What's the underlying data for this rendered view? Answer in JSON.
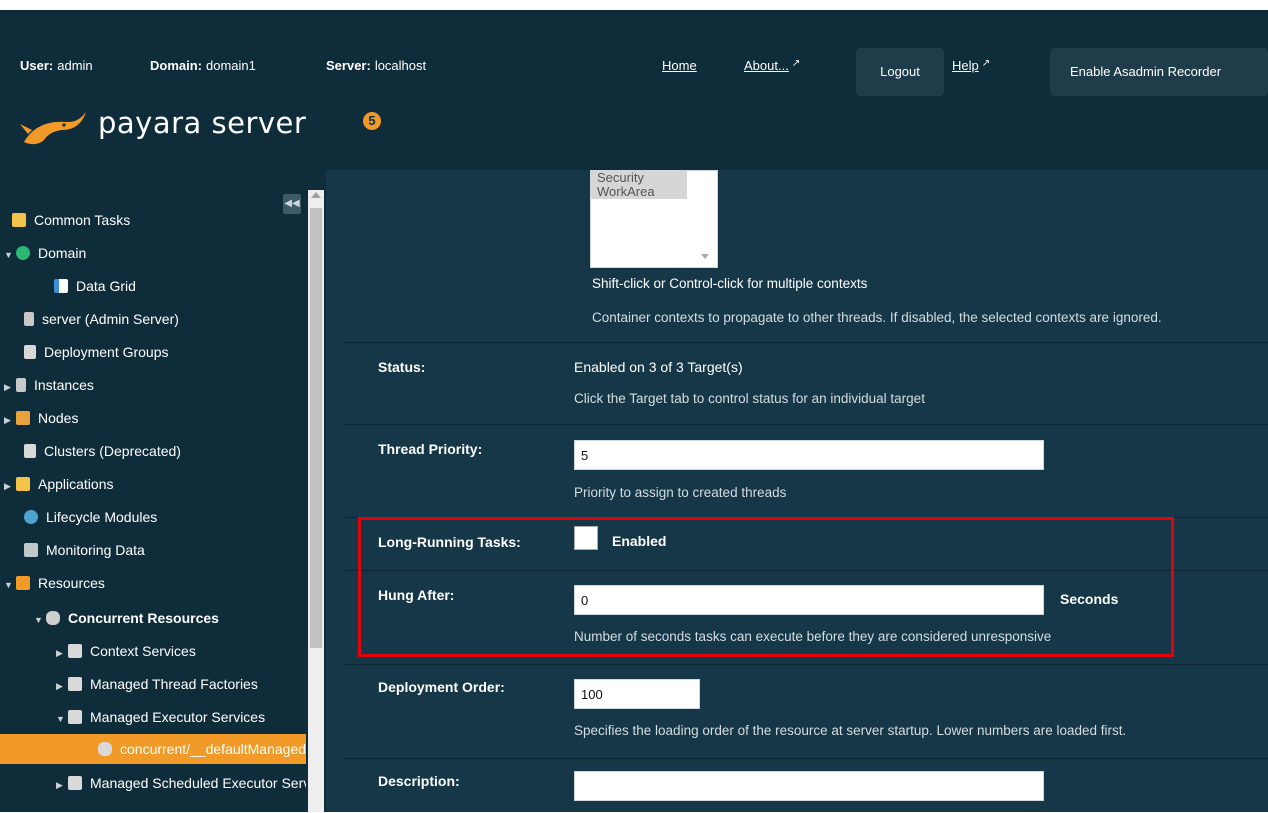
{
  "header": {
    "user_label": "User:",
    "user_value": "admin",
    "domain_label": "Domain:",
    "domain_value": "domain1",
    "server_label": "Server:",
    "server_value": "localhost",
    "home_link": "Home",
    "about_link": "About...",
    "logout_button": "Logout",
    "help_link": "Help",
    "recorder_button": "Enable Asadmin Recorder",
    "logo_text": "payara server",
    "logo_badge": "5"
  },
  "sidebar": {
    "items": [
      {
        "label": "Common Tasks",
        "icon": "tasks-icon"
      },
      {
        "label": "Domain",
        "icon": "globe-icon"
      },
      {
        "label": "Data Grid",
        "icon": "datagrid-icon"
      },
      {
        "label": "server (Admin Server)",
        "icon": "server-icon"
      },
      {
        "label": "Deployment Groups",
        "icon": "hierarchy-icon"
      },
      {
        "label": "Instances",
        "icon": "server-icon"
      },
      {
        "label": "Nodes",
        "icon": "monitor-icon"
      },
      {
        "label": "Clusters (Deprecated)",
        "icon": "hierarchy-icon"
      },
      {
        "label": "Applications",
        "icon": "applications-icon"
      },
      {
        "label": "Lifecycle Modules",
        "icon": "gear-icon"
      },
      {
        "label": "Monitoring Data",
        "icon": "monitor-icon"
      },
      {
        "label": "Resources",
        "icon": "resources-icon"
      },
      {
        "label": "Concurrent Resources",
        "icon": "database-icon"
      },
      {
        "label": "Context Services",
        "icon": "folder-icon"
      },
      {
        "label": "Managed Thread Factories",
        "icon": "folder-icon"
      },
      {
        "label": "Managed Executor Services",
        "icon": "folder-icon"
      },
      {
        "label": "concurrent/__defaultManagedExecutorService",
        "icon": "database-icon"
      },
      {
        "label": "Managed Scheduled Executor Services",
        "icon": "folder-icon"
      }
    ]
  },
  "form": {
    "context_options": [
      "Security",
      "WorkArea"
    ],
    "context_help1": "Shift-click or Control-click for multiple contexts",
    "context_help2": "Container contexts to propagate to other threads. If disabled, the selected contexts are ignored.",
    "status_label": "Status:",
    "status_value": "Enabled on 3 of 3 Target(s)",
    "status_help": "Click the Target tab to control status for an individual target",
    "thread_priority_label": "Thread Priority:",
    "thread_priority_value": "5",
    "thread_priority_help": "Priority to assign to created threads",
    "long_running_label": "Long-Running Tasks:",
    "long_running_checkbox_label": "Enabled",
    "hung_after_label": "Hung After:",
    "hung_after_value": "0",
    "hung_after_unit": "Seconds",
    "hung_after_help": "Number of seconds tasks can execute before they are considered unresponsive",
    "deployment_order_label": "Deployment Order:",
    "deployment_order_value": "100",
    "deployment_order_help": "Specifies the loading order of the resource at server startup. Lower numbers are loaded first.",
    "description_label": "Description:",
    "description_value": ""
  }
}
